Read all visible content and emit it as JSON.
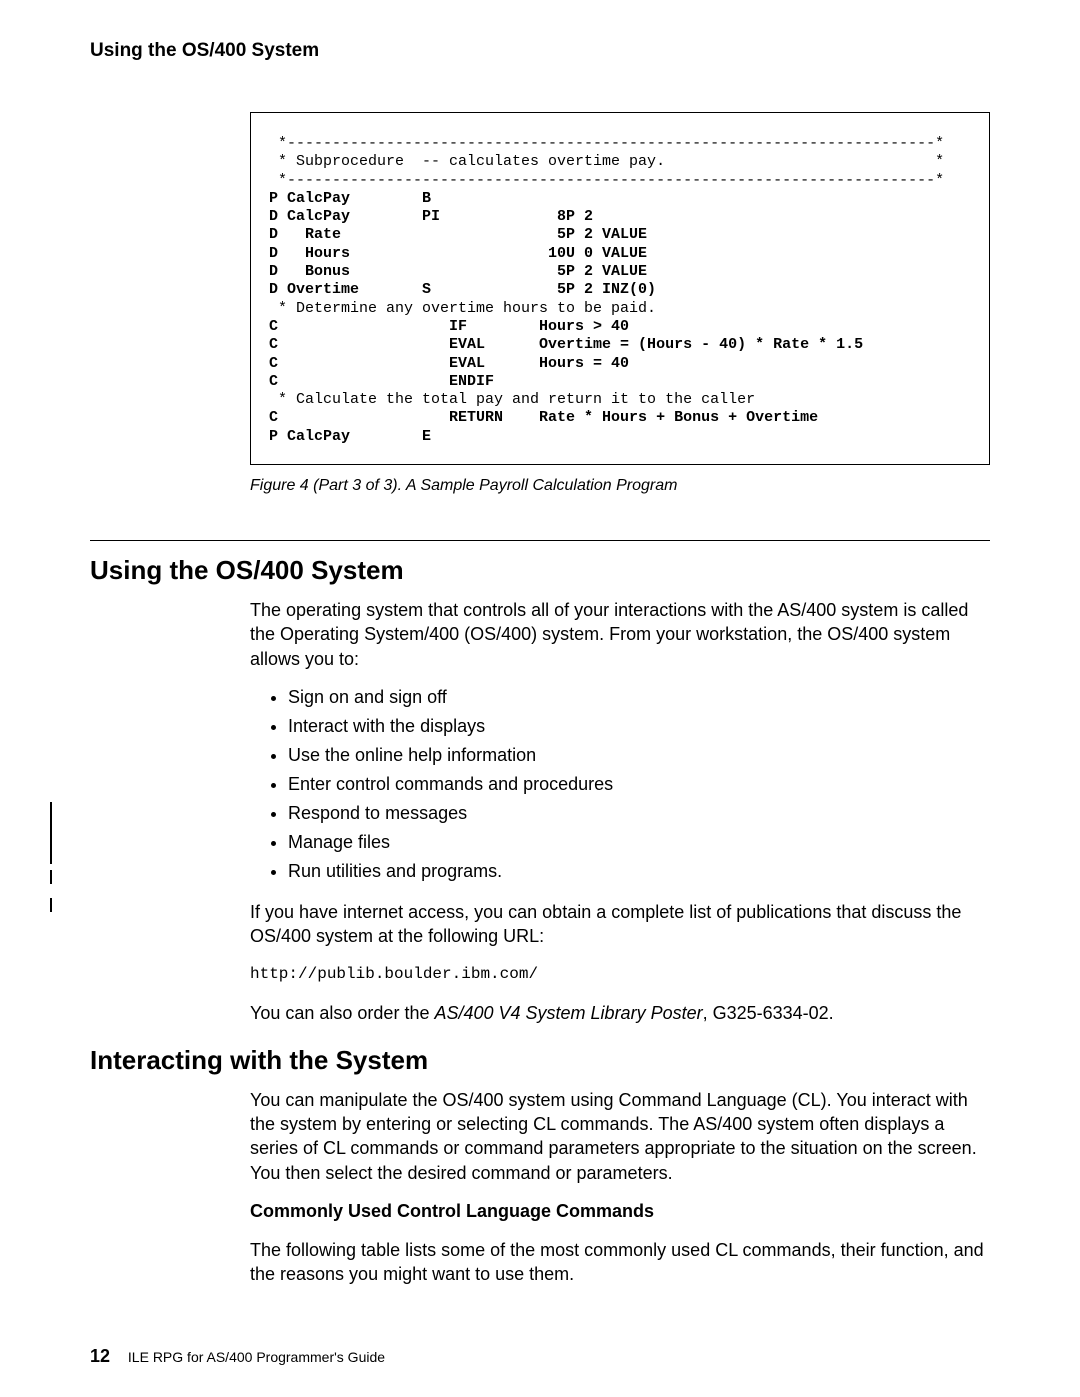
{
  "header": {
    "running_title": "Using the OS/400 System"
  },
  "code": {
    "lines": [
      " *------------------------------------------------------------------------*",
      " * Subprocedure  -- calculates overtime pay.                              *",
      " *------------------------------------------------------------------------*",
      "P CalcPay        B",
      "D CalcPay        PI             8P 2",
      "D   Rate                        5P 2 VALUE",
      "D   Hours                      10U 0 VALUE",
      "D   Bonus                       5P 2 VALUE",
      "D Overtime       S              5P 2 INZ(0)",
      " * Determine any overtime hours to be paid.",
      "C                   IF        Hours > 40",
      "C                   EVAL      Overtime = (Hours - 40) * Rate * 1.5",
      "C                   EVAL      Hours = 40",
      "C                   ENDIF",
      " * Calculate the total pay and return it to the caller",
      "C                   RETURN    Rate * Hours + Bonus + Overtime",
      "P CalcPay        E"
    ],
    "weak_lines": [
      0,
      1,
      2,
      9,
      14
    ]
  },
  "figure_caption": "Figure 4 (Part 3 of 3).  A Sample Payroll Calculation Program",
  "section1": {
    "heading": "Using the OS/400 System",
    "para1": "The operating system that controls all of your interactions with the AS/400 system is called the Operating System/400 (OS/400) system. From your workstation, the OS/400 system allows you to:",
    "bullets": [
      "Sign on and sign off",
      "Interact with the displays",
      "Use the online help information",
      "Enter control commands and procedures",
      "Respond to messages",
      "Manage files",
      "Run utilities and programs."
    ],
    "para2": "If you have internet access, you can obtain a complete list of publications that discuss the OS/400 system at the following URL:",
    "url": "http://publib.boulder.ibm.com/",
    "para3_a": "You can also order the ",
    "para3_i": "AS/400 V4 System Library Poster",
    "para3_b": ", G325-6334-02."
  },
  "section2": {
    "heading": "Interacting with the System",
    "para1": "You can manipulate the OS/400 system using Command Language (CL). You interact with the system by entering or selecting CL commands. The AS/400 system often displays a series of CL commands or command parameters appropriate to the situation on the screen. You then select the desired command or parameters.",
    "subhead": "Commonly Used Control Language Commands",
    "para2": "The following table lists some of the most commonly used CL commands, their function, and the reasons you might want to use them."
  },
  "footer": {
    "page": "12",
    "book": "ILE RPG for AS/400 Programmer's Guide"
  }
}
